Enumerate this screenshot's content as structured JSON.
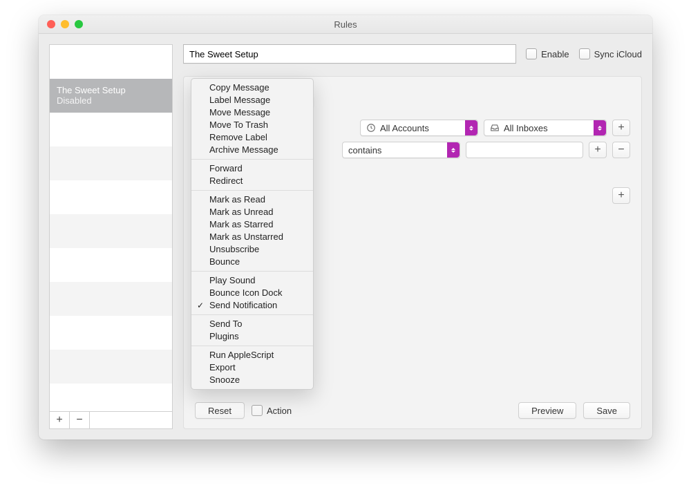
{
  "window": {
    "title": "Rules"
  },
  "sidebar": {
    "selected": {
      "name": "The Sweet Setup",
      "status": "Disabled"
    },
    "add_label": "+",
    "remove_label": "−"
  },
  "toprow": {
    "rule_name": "The Sweet Setup",
    "enable_label": "Enable",
    "sync_label": "Sync iCloud"
  },
  "rows": {
    "row1": {
      "accounts": "All Accounts",
      "inboxes": "All Inboxes"
    },
    "row2": {
      "condition": "contains",
      "value": ""
    }
  },
  "footer": {
    "reset": "Reset",
    "action_label": "Action",
    "preview": "Preview",
    "save": "Save"
  },
  "glyphs": {
    "plus": "+",
    "minus": "−"
  },
  "menu": {
    "groups": [
      [
        "Copy Message",
        "Label Message",
        "Move Message",
        "Move To Trash",
        "Remove Label",
        "Archive Message"
      ],
      [
        "Forward",
        "Redirect"
      ],
      [
        "Mark as Read",
        "Mark as Unread",
        "Mark as Starred",
        "Mark as Unstarred",
        "Unsubscribe",
        "Bounce"
      ],
      [
        "Play Sound",
        "Bounce Icon Dock",
        "Send Notification"
      ],
      [
        "Send To",
        "Plugins"
      ],
      [
        "Run AppleScript",
        "Export",
        "Snooze"
      ]
    ],
    "checked": "Send Notification"
  }
}
